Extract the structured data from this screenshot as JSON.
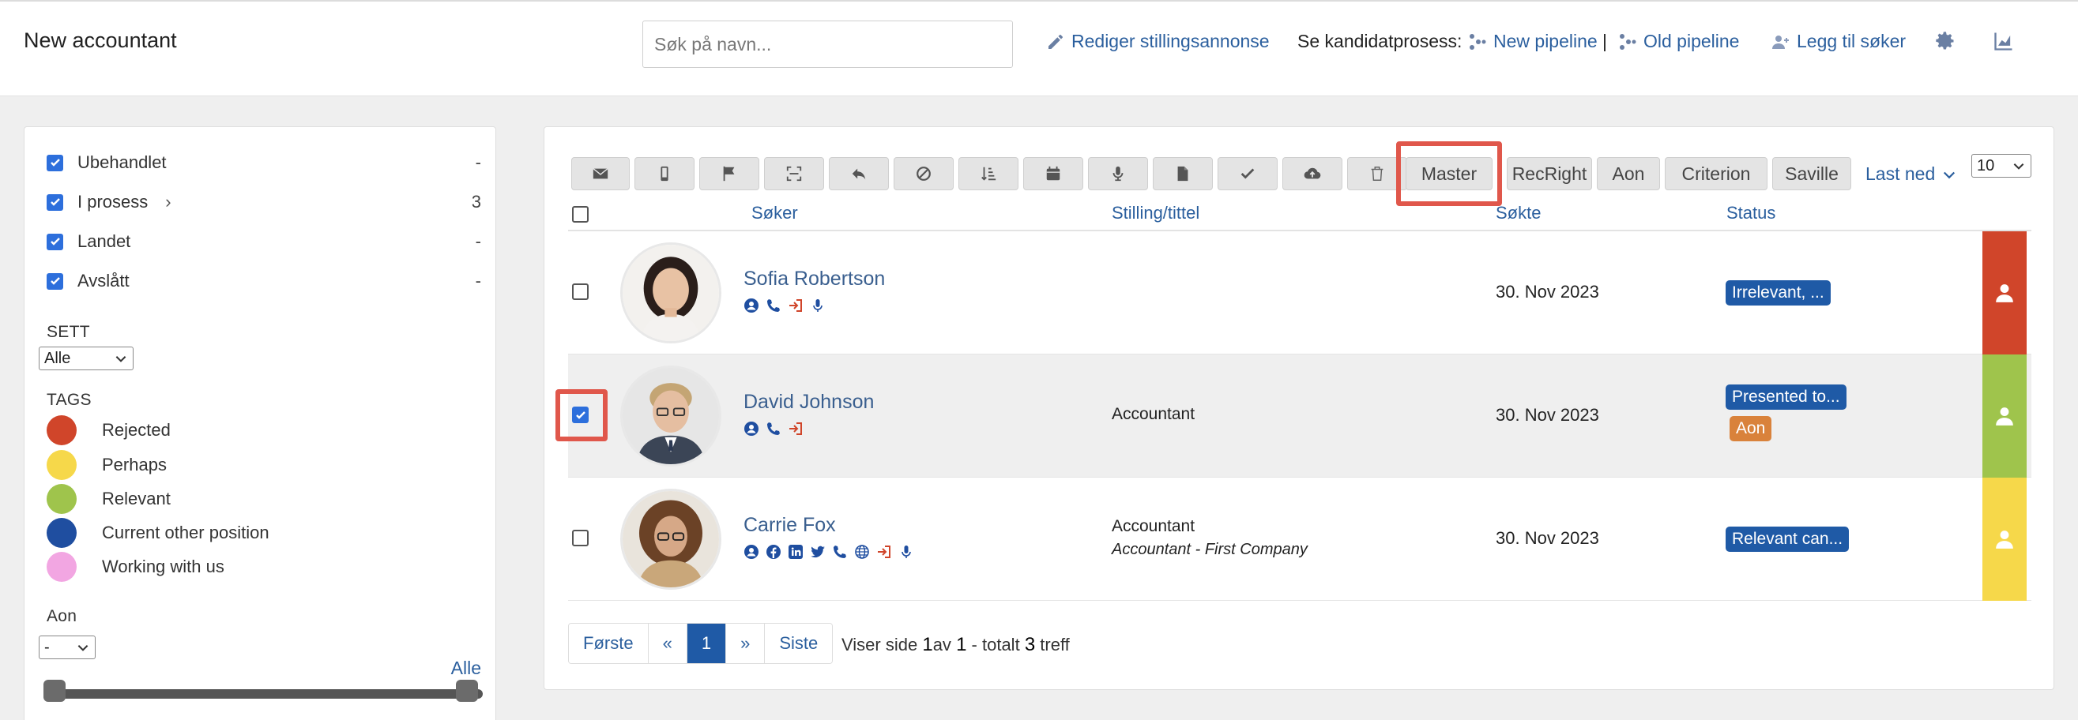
{
  "header": {
    "title": "New accountant",
    "search_placeholder": "Søk på navn...",
    "edit_ad": "Rediger stillingsannonse",
    "process_label": "Se kandidatprosess:",
    "new_pipeline": "New pipeline",
    "separator": "|",
    "old_pipeline": "Old pipeline",
    "add_applicant": "Legg til søker"
  },
  "sidebar": {
    "filters": [
      {
        "label": "Ubehandlet",
        "count": "-"
      },
      {
        "label": "I prosess",
        "count": "3"
      },
      {
        "label": "Landet",
        "count": "-"
      },
      {
        "label": "Avslått",
        "count": "-"
      }
    ],
    "sett_label": "SETT",
    "sett_value": "Alle",
    "tags_label": "TAGS",
    "tags": [
      {
        "label": "Rejected",
        "color": "#d0452a"
      },
      {
        "label": "Perhaps",
        "color": "#f6d84a"
      },
      {
        "label": "Relevant",
        "color": "#9fc44c"
      },
      {
        "label": "Current other position",
        "color": "#1f4ea0"
      },
      {
        "label": "Working with us",
        "color": "#f2a6e2"
      }
    ],
    "aon_label": "Aon",
    "aon_value": "-",
    "alle_link": "Alle"
  },
  "toolbar": {
    "text_buttons": [
      "Master",
      "RecRight",
      "Aon",
      "Criterion",
      "Saville"
    ],
    "last_ned": "Last ned",
    "per_page": "10"
  },
  "table": {
    "headers": {
      "applicant": "Søker",
      "position": "Stilling/tittel",
      "applied": "Søkte",
      "status": "Status"
    },
    "rows": [
      {
        "name": "Sofia Robertson",
        "position": "",
        "position_sub": "",
        "date": "30. Nov 2023",
        "status": "Irrelevant, ...",
        "status2": "",
        "tag_color": "#d0452a",
        "selected": false
      },
      {
        "name": "David Johnson",
        "position": "Accountant",
        "position_sub": "",
        "date": "30. Nov 2023",
        "status": "Presented to...",
        "status2": "Aon",
        "tag_color": "#9fc44c",
        "selected": true
      },
      {
        "name": "Carrie Fox",
        "position": "Accountant",
        "position_sub": "Accountant - First Company",
        "date": "30. Nov 2023",
        "status": "Relevant can...",
        "status2": "",
        "tag_color": "#f6d84a",
        "selected": false
      }
    ]
  },
  "pagination": {
    "first": "Første",
    "prev": "«",
    "current": "1",
    "next": "»",
    "last": "Siste",
    "info_prefix": "Viser side",
    "page": "1",
    "info_of": "av",
    "total_pages": "1",
    "info_total": "- totalt",
    "total": "3",
    "info_suffix": "treff"
  }
}
